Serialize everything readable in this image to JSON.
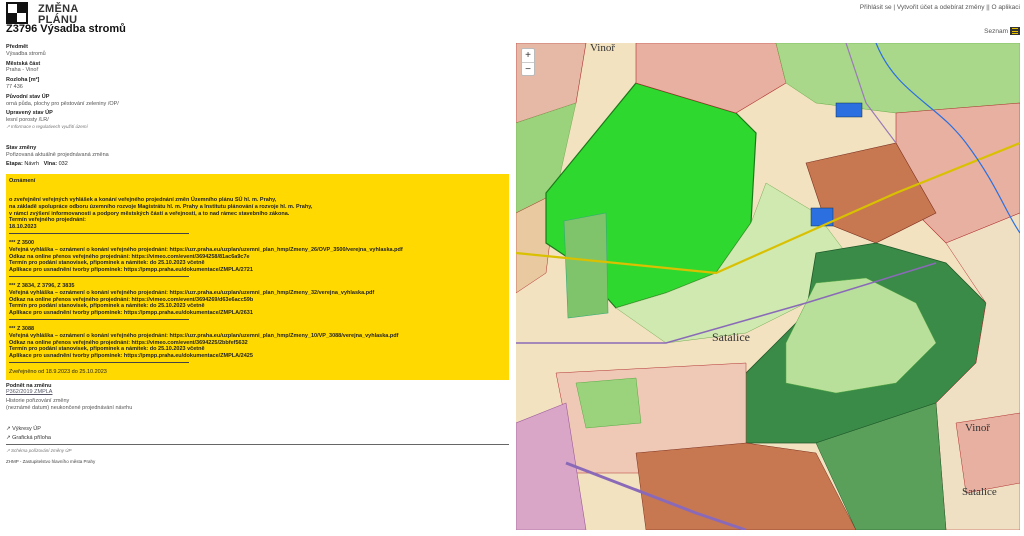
{
  "header": {
    "brand_line1": "ZMĚNA",
    "brand_line2": "PLÁNU",
    "title": "Z3796 Výsadba stromů",
    "nav_login": "Přihlásit se",
    "nav_sep1": " | ",
    "nav_create": "Vytvořit účet a odebírat změny",
    "nav_sep2": " || ",
    "nav_about": "O aplikaci",
    "list_label": "Seznam"
  },
  "details": {
    "subject_label": "Předmět",
    "subject_value": "Výsadba stromů",
    "district_label": "Městská část",
    "district_value": "Praha - Vinoř",
    "area_label": "Rozloha [m²]",
    "area_value": "77 436",
    "orig_label": "Původní stav ÚP",
    "orig_value": "orná půda, plochy pro pěstování zeleniny /OP/",
    "new_label": "Upravený stav ÚP",
    "new_value": "lesní porosty /LR/",
    "reg_note": "↗ Informace o regulativech využití území",
    "state_label": "Stav změny",
    "state_value": "Pořizovaná aktuálně projednávaná změna",
    "stage_label": "Etapa:",
    "stage_value": "Návrh",
    "wave_label": "Vlna:",
    "wave_value": "032"
  },
  "notice": {
    "title": "Oznámení",
    "intro": [
      "o zveřejnění veřejných vyhlášek a konání veřejného projednání změn Územního plánu SÚ hl. m. Prahy,",
      "na základě spolupráce odboru územního rozvoje Magistrátu hl. m. Prahy a Institutu plánování a rozvoje hl. m. Prahy,",
      "v rámci zvýšení informovanosti a podpory městských částí a veřejnosti, a to nad rámec stavebního zákona.",
      "Termín veřejného projednání:",
      "18.10.2023"
    ],
    "blocks": [
      {
        "head": "*** Z 3500",
        "lines": [
          "Veřejná vyhláška – oznámení o konání veřejného projednání: https://uzr.praha.eu/uzplan/uzemni_plan_hmp/Zmeny_26/OVP_3500/verejna_vyhlaska.pdf",
          "Odkaz na online přenos veřejného projednání: https://vimeo.com/event/3694258/81ac6a9c7e",
          "Termín pro podání stanovisek, připomínek a námitek: do 25.10.2023 včetně",
          "Aplikace pro usnadnění tvorby připomínek: https://pmpp.praha.eu/dokumentace/ZMPLA/2721"
        ]
      },
      {
        "head": "*** Z 3834, Z 3796, Z 3835",
        "lines": [
          "Veřejná vyhláška – oznámení o konání veřejného projednání: https://uzr.praha.eu/uzplan/uzemni_plan_hmp/Zmeny_32/verejna_vyhlaska.pdf",
          "Odkaz na online přenos veřejného projednání: https://vimeo.com/event/3694269/d63e6acc59b",
          "Termín pro podání stanovisek, připomínek a námitek: do 25.10.2023 včetně",
          "Aplikace pro usnadnění tvorby připomínek: https://pmpp.praha.eu/dokumentace/ZMPLA/2631"
        ]
      },
      {
        "head": "*** Z 3088",
        "lines": [
          "Veřejná vyhláška – oznámení o konání veřejného projednání: https://uzr.praha.eu/uzplan/uzemni_plan_hmp/Zmeny_10/VP_3088/verejna_vyhlaska.pdf",
          "Odkaz na online přenos veřejného projednání: https://vimeo.com/event/3694225/2bbfef5632",
          "Termín pro podání stanovisek, připomínek a námitek: do 25.10.2023 včetně",
          "Aplikace pro usnadnění tvorby připomínek: https://pmpp.praha.eu/dokumentace/ZMPLA/2425"
        ]
      }
    ],
    "published": "Zveřejněno od 18.9.2023 do 25.10.2023"
  },
  "footer": {
    "proposal_label": "Podnět na změnu",
    "proposal_link": "P362/2019 ZMPLA",
    "history_label": "Historie pořizování změny",
    "history_value": "(neznámé datum) neukončené projednávání návrhu",
    "extracts_link": "↗ Výkresy ÚP",
    "graphic_link": "↗ Grafická příloha",
    "scheme_note": "↗ Schéma pořizování změny ÚP",
    "authority": "ZHMP - Zastupitelstvo hlavního města Prahy"
  },
  "map": {
    "zoom_in": "+",
    "zoom_out": "−",
    "place_vinor_top": "Vinoř",
    "place_satalice": "Satalice",
    "place_vinor_bottom": "Vinoř",
    "place_satalice_bottom": "Satalice",
    "colors": {
      "highlight": "#2fd82f",
      "forest": "#3a8a48",
      "meadow": "#9bd37c",
      "arable": "#f2dfb8",
      "residential": "#e8b0a0",
      "industrial": "#c87850",
      "water": "#2b6fe0",
      "road": "#9a7ab8",
      "border": "#b03030"
    }
  }
}
